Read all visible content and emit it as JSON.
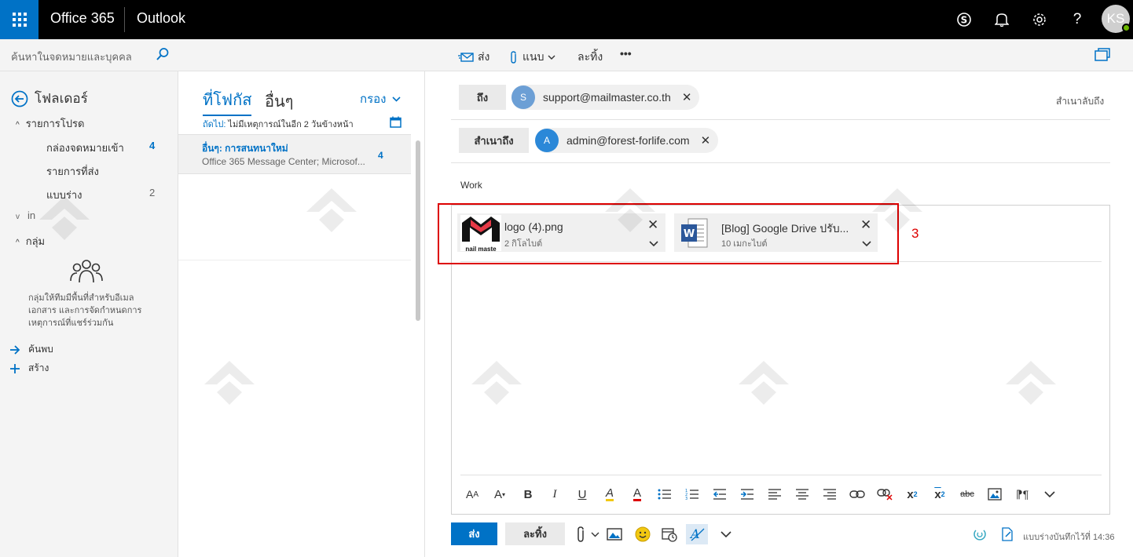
{
  "topbar": {
    "brand": "Office 365",
    "app": "Outlook",
    "avatar_initials": "KS",
    "icons": [
      "app-launcher-icon",
      "skype-icon",
      "bell-icon",
      "gear-icon",
      "help-icon"
    ]
  },
  "search": {
    "placeholder": "ค้นหาในจดหมายและบุคคล"
  },
  "commands": {
    "send": "ส่ง",
    "attach": "แนบ",
    "discard": "ละทิ้ง",
    "more": "•••"
  },
  "nav": {
    "folders_title": "โฟลเดอร์",
    "favorites_label": "รายการโปรด",
    "inbox": {
      "label": "กล่องจดหมายเข้า",
      "count": "4"
    },
    "sent": {
      "label": "รายการที่ส่ง"
    },
    "drafts": {
      "label": "แบบร่าง",
      "count": "2"
    },
    "account_label": "in",
    "groups_label": "กลุ่ม",
    "groups_desc": "กลุ่มให้ทีมมีพื้นที่สำหรับอีเมล เอกสาร และการจัดกำหนดการเหตุการณ์ที่แชร์ร่วมกัน",
    "discover": "ค้นพบ",
    "create": "สร้าง"
  },
  "list": {
    "tab_focused": "ที่โฟกัส",
    "tab_other": "อื่นๆ",
    "filter": "กรอง",
    "next_prefix": "ถัดไป:",
    "next_text": " ไม่มีเหตุการณ์ในอีก 2 วันข้างหน้า",
    "item": {
      "subject": "อื่นๆ: การสนทนาใหม่",
      "from": "Office 365 Message Center; Microsof...",
      "count": "4"
    }
  },
  "compose": {
    "to_label": "ถึง",
    "to_initial": "S",
    "to_email": "support@mailmaster.co.th",
    "cc_label": "สำเนาถึง",
    "cc_initial": "A",
    "cc_email": "admin@forest-forlife.com",
    "bcc_label": "สำเนาลับถึง",
    "subject": "Work",
    "attachments": [
      {
        "name": "logo (4).png",
        "size": "2 กิโลไบต์",
        "thumb_text": "nail maste"
      },
      {
        "name": "[Blog] Google Drive ปรับ...",
        "size": "10 เมกะไบต์"
      }
    ],
    "annotation_number": "3",
    "send_label": "ส่ง",
    "discard_label": "ละทิ้ง",
    "saved_text": "แบบร่างบันทึกไว้ที่ 14:36"
  },
  "colors": {
    "accent": "#0072c6",
    "topbar": "#000000",
    "annotation": "#dd0000",
    "avatar_s": "#5c9bd5",
    "avatar_a": "#2b88d8"
  }
}
